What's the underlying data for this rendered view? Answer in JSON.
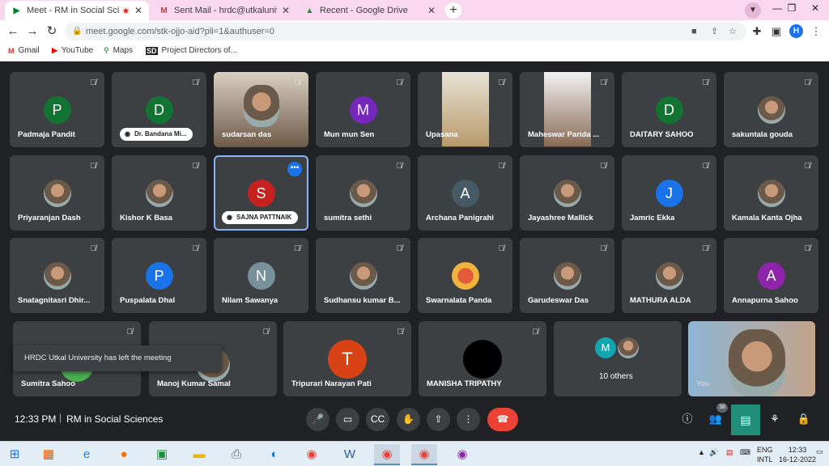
{
  "browser": {
    "tabs": [
      {
        "title": "Meet - RM in Social Sciences",
        "icon": "meet-icon",
        "active": true
      },
      {
        "title": "Sent Mail - hrdc@utkaluniversity",
        "icon": "gmail-icon",
        "active": false
      },
      {
        "title": "Recent - Google Drive",
        "icon": "drive-icon",
        "active": false
      }
    ],
    "url": "meet.google.com/stk-ojjo-aid?pli=1&authuser=0",
    "profile_initial": "H",
    "bookmarks": [
      {
        "label": "Gmail",
        "icon": "gmail-icon"
      },
      {
        "label": "YouTube",
        "icon": "youtube-icon"
      },
      {
        "label": "Maps",
        "icon": "maps-icon"
      },
      {
        "label": "Project Directors of...",
        "icon": "sdm-icon"
      }
    ]
  },
  "meet": {
    "participants": [
      {
        "name": "Padmaja Pandit",
        "initial": "P",
        "color": "#137333"
      },
      {
        "name": "Dr. Bandana Mi...",
        "initial": "D",
        "color": "#137333",
        "pill": true
      },
      {
        "name": "sudarsan das",
        "video": true
      },
      {
        "name": "Mun mun Sen",
        "initial": "M",
        "color": "#7627bb"
      },
      {
        "name": "Upasana",
        "video": true
      },
      {
        "name": "Maheswar Parida ...",
        "video": true
      },
      {
        "name": "DAITARY SAHOO",
        "initial": "D",
        "color": "#137333"
      },
      {
        "name": "sakuntala gouda",
        "photo": true
      },
      {
        "name": "Priyaranjan Dash",
        "photo": true
      },
      {
        "name": "Kishor K Basa",
        "photo": true
      },
      {
        "name": "SAJNA PATTNAIK",
        "initial": "S",
        "color": "#c5221f",
        "pill": true,
        "selected": true
      },
      {
        "name": "sumitra sethi",
        "photo": true
      },
      {
        "name": "Archana Panigrahi",
        "initial": "A",
        "color": "#455a64"
      },
      {
        "name": "Jayashree Mallick",
        "photo": true
      },
      {
        "name": "Jamric Ekka",
        "initial": "J",
        "color": "#1a73e8"
      },
      {
        "name": "Kamala Kanta Ojha",
        "photo": true
      },
      {
        "name": "Snatagnitasri Dhir...",
        "photo": true
      },
      {
        "name": "Puspalata Dhal",
        "initial": "P",
        "color": "#1a73e8"
      },
      {
        "name": "Nilam Sawanya",
        "initial": "N",
        "color": "#78909c"
      },
      {
        "name": "Sudhansu kumar B...",
        "photo": true
      },
      {
        "name": "Swarnalata Panda",
        "photo": true
      },
      {
        "name": "Garudeswar Das",
        "photo": true
      },
      {
        "name": "MATHURA ALDA",
        "photo": true
      },
      {
        "name": "Annapurna Sahoo",
        "initial": "A",
        "color": "#8e24aa"
      },
      {
        "name": "Sumitra Sahoo",
        "initial": "",
        "color": "#4caf50"
      },
      {
        "name": "Manoj Kumar Samal",
        "photo": true
      },
      {
        "name": "Tripurari Narayan Pati",
        "initial": "T",
        "color": "#d84315"
      },
      {
        "name": "MANISHA TRIPATHY",
        "initial": "",
        "color": "#000000"
      },
      {
        "name": "10 others",
        "initial": "M",
        "color": "#12a4af"
      },
      {
        "name": "You",
        "video": true
      }
    ],
    "toast": "HRDC Utkal University has left the meeting",
    "time": "12:33 PM",
    "meeting_title": "RM in Social Sciences",
    "participant_count": "38",
    "controls": [
      "mic-icon",
      "camera-icon",
      "captions-icon",
      "raise-hand-icon",
      "present-icon",
      "more-icon",
      "end-call-icon"
    ]
  },
  "taskbar": {
    "lang_top": "ENG",
    "lang_bottom": "INTL",
    "time": "12:33",
    "date": "16-12-2022"
  }
}
